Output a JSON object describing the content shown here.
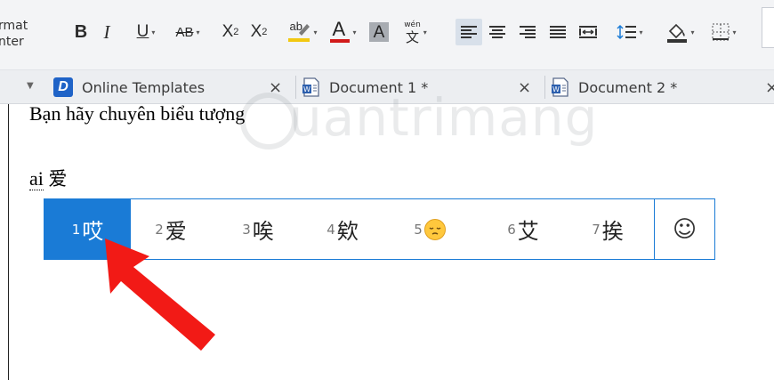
{
  "ribbon": {
    "format_painter_lines": [
      "rmat",
      "nter"
    ],
    "bold": "B",
    "italic": "I",
    "underline": "U",
    "strikethrough": "AB",
    "superscript": "X",
    "superscript_mark": "2",
    "subscript": "X",
    "subscript_mark": "2",
    "highlight_glyph": "ab",
    "font_color_glyph": "A",
    "char_shading_glyph": "A",
    "phonetic_top": "wén",
    "phonetic_bottom": "文",
    "dropdown_glyph": "▾"
  },
  "tabs": [
    {
      "label": "Online Templates",
      "close": "×"
    },
    {
      "label": "Document 1 *",
      "close": "×"
    },
    {
      "label": "Document 2 *",
      "close": "×"
    }
  ],
  "tabbar": {
    "menu_glyph": "▼"
  },
  "document": {
    "line1": "Bạn hãy chuyên biểu tượng",
    "line2_roman": "ai",
    "line2_hanzi": "爱"
  },
  "watermark": {
    "text": "uantrimang"
  },
  "ime": {
    "candidates": [
      {
        "num": "1",
        "text": "哎"
      },
      {
        "num": "2",
        "text": "爱"
      },
      {
        "num": "3",
        "text": "唉"
      },
      {
        "num": "4",
        "text": "欸"
      },
      {
        "num": "5",
        "text": "",
        "emoji": "pensive-face"
      },
      {
        "num": "6",
        "text": "艾"
      },
      {
        "num": "7",
        "text": "挨"
      }
    ],
    "emoji_button": "☺",
    "selected_index": 0
  },
  "colors": {
    "accent": "#1a7bd6",
    "arrow": "#f21a16",
    "highlight_bar": "#f2c811",
    "font_color_bar": "#d11a1a",
    "logo_blue": "#1f63c7"
  }
}
